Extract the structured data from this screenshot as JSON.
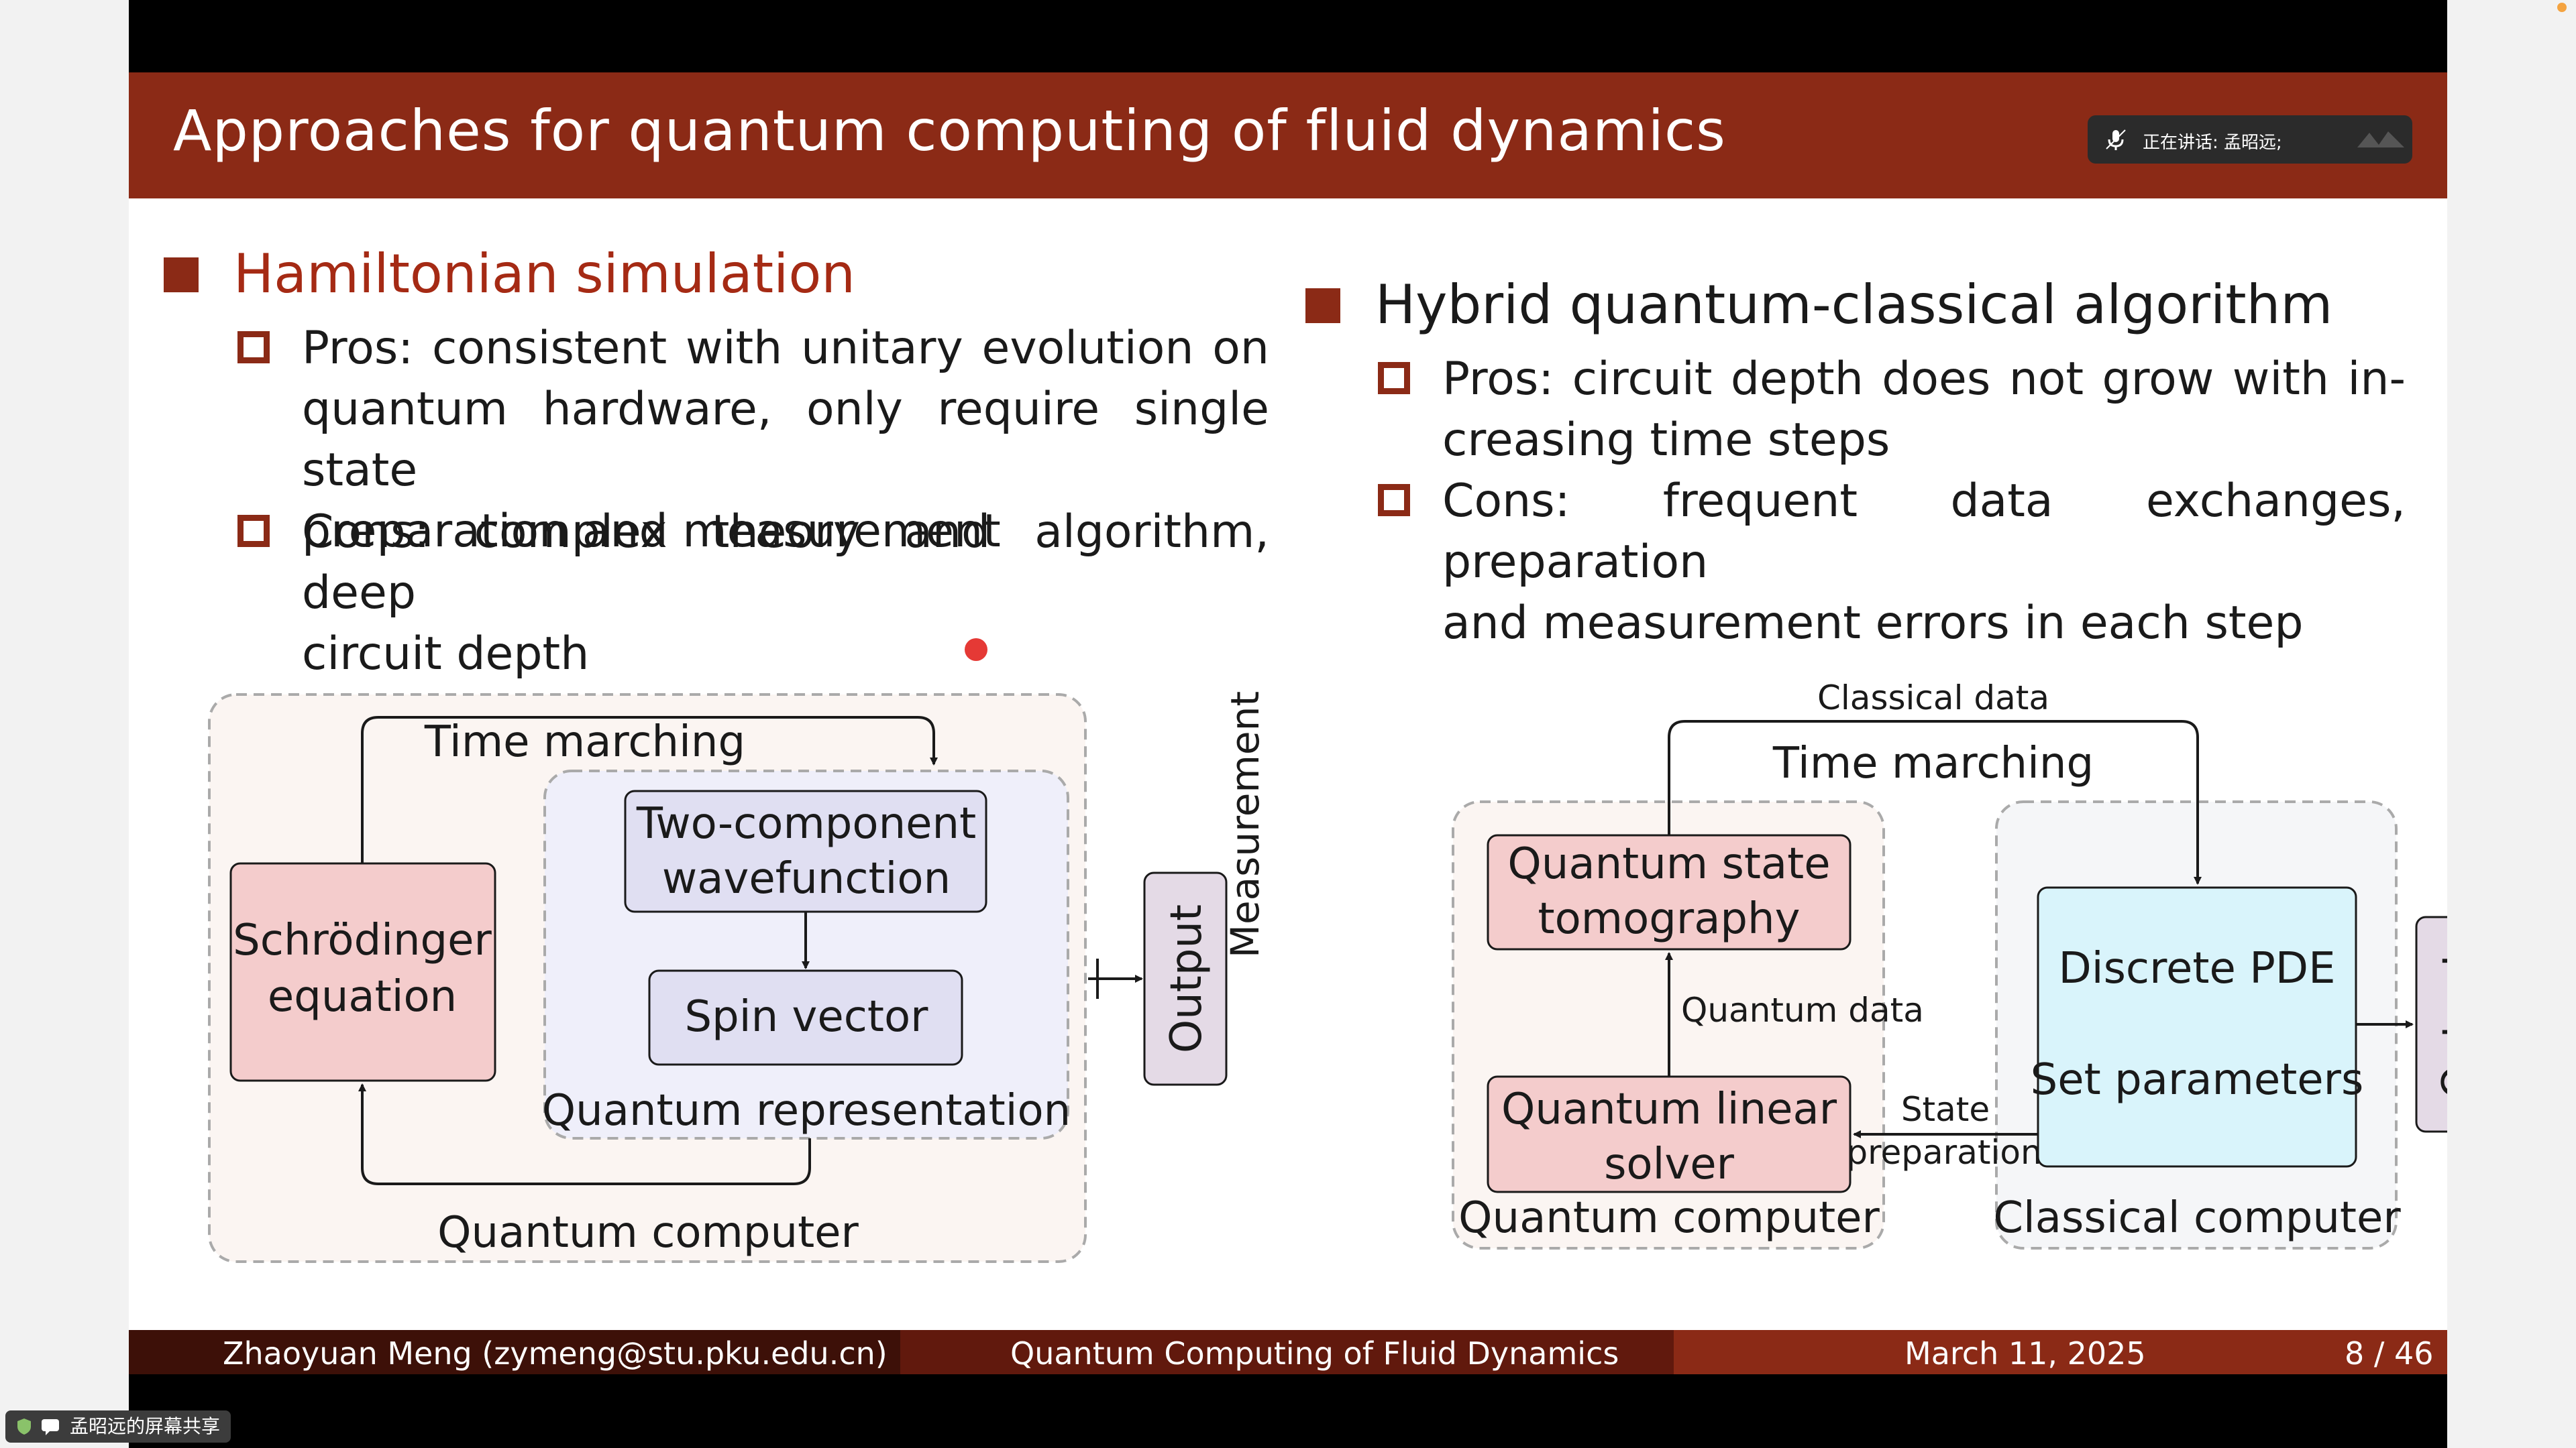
{
  "slide": {
    "title": "Approaches for quantum computing of fluid dynamics",
    "speaker_status": "正在讲话:  孟昭远;",
    "left": {
      "heading": "Hamiltonian simulation",
      "pros": [
        "Pros: consistent with unitary evolution on",
        "quantum hardware, only require single state",
        "preparation and measurement"
      ],
      "cons": [
        "Cons: complex theory and algorithm, deep",
        "circuit depth"
      ]
    },
    "right": {
      "heading": "Hybrid quantum-classical algorithm",
      "pros": [
        "Pros: circuit depth does not grow with in-",
        "creasing time steps"
      ],
      "cons": [
        "Cons: frequent data exchanges, preparation",
        "and measurement errors in each step"
      ]
    },
    "diagram_left": {
      "time_marching": "Time marching",
      "schrodinger": [
        "Schrödinger",
        "equation"
      ],
      "two_component": [
        "Two-component",
        "wavefunction"
      ],
      "spin_vector": "Spin vector",
      "quantum_representation": "Quantum representation",
      "measurement": "Measurement",
      "output": "Output",
      "quantum_computer": "Quantum computer"
    },
    "diagram_right": {
      "classical_data": "Classical data",
      "time_marching": "Time marching",
      "tomography": [
        "Quantum state",
        "tomography"
      ],
      "quantum_data": "Quantum data",
      "linear_solver": [
        "Quantum linear",
        "solver"
      ],
      "state_preparation": [
        "State",
        "preparation"
      ],
      "discrete_pde": "Discrete PDE",
      "set_parameters": "Set parameters",
      "output": "Output",
      "quantum_computer": "Quantum computer",
      "classical_computer": "Classical computer"
    },
    "footer": {
      "author": "Zhaoyuan Meng  (zymeng@stu.pku.edu.cn)",
      "talk_title": "Quantum Computing of Fluid Dynamics",
      "date": "March 11, 2025",
      "page": "8 / 46"
    }
  },
  "share_label": "孟昭远的屏幕共享",
  "colors": {
    "title_bar": "#8b2a16",
    "accent": "#8b2a16",
    "pink_box": "#f4cccc",
    "lavender_box": "#e0dff2",
    "cyan_box": "#d9f4fb"
  }
}
